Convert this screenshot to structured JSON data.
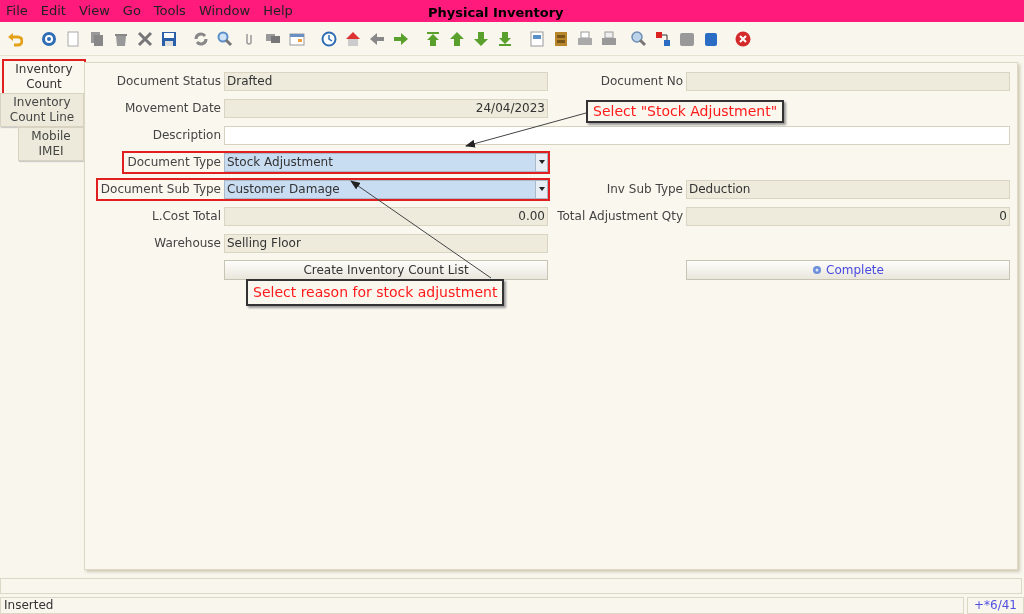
{
  "window": {
    "title": "Physical Inventory"
  },
  "menu": [
    "File",
    "Edit",
    "View",
    "Go",
    "Tools",
    "Window",
    "Help"
  ],
  "tabs": [
    {
      "label": "Inventory Count",
      "selected": true,
      "highlighted": true
    },
    {
      "label": "Inventory Count Line",
      "selected": false,
      "highlighted": false
    },
    {
      "label": "Mobile IMEI",
      "selected": false,
      "highlighted": false
    }
  ],
  "form": {
    "rows": [
      [
        {
          "kind": "readonly",
          "label": "Document Status",
          "value": "Drafted",
          "highlighted": false
        },
        {
          "kind": "readonly",
          "label": "Document No",
          "highlighted": false
        }
      ],
      [
        {
          "kind": "number",
          "label": "Movement Date",
          "value": "24/04/2023",
          "highlighted": false
        }
      ],
      [
        {
          "kind": "wide",
          "label": "Description",
          "highlighted": false
        }
      ],
      [
        {
          "kind": "select",
          "label": "Document Type",
          "value": "Stock Adjustment",
          "highlighted": true
        }
      ],
      [
        {
          "kind": "select",
          "label": "Document Sub Type",
          "value": "Customer Damage",
          "highlighted": true
        },
        {
          "kind": "readonly",
          "label": "Inv Sub Type",
          "value": "Deduction",
          "highlighted": false
        }
      ],
      [
        {
          "kind": "number",
          "label": "L.Cost Total",
          "value": "0.00",
          "highlighted": false
        },
        {
          "kind": "number",
          "label": "Total Adjustment Qty",
          "value": "0",
          "highlighted": false
        }
      ],
      [
        {
          "kind": "readonly",
          "label": "Warehouse",
          "value": "Selling Floor",
          "highlighted": false
        }
      ],
      [
        {
          "kind": "button",
          "label": "Create Inventory Count List",
          "highlighted": false
        },
        {
          "kind": "action",
          "label": "Complete",
          "highlighted": false
        }
      ]
    ]
  },
  "annotations": [
    {
      "text": "Select \"Stock Adjustment\""
    },
    {
      "text": "Select reason for stock adjustment"
    }
  ],
  "status_bar": {
    "message": "Inserted",
    "record": "+*6/41"
  }
}
